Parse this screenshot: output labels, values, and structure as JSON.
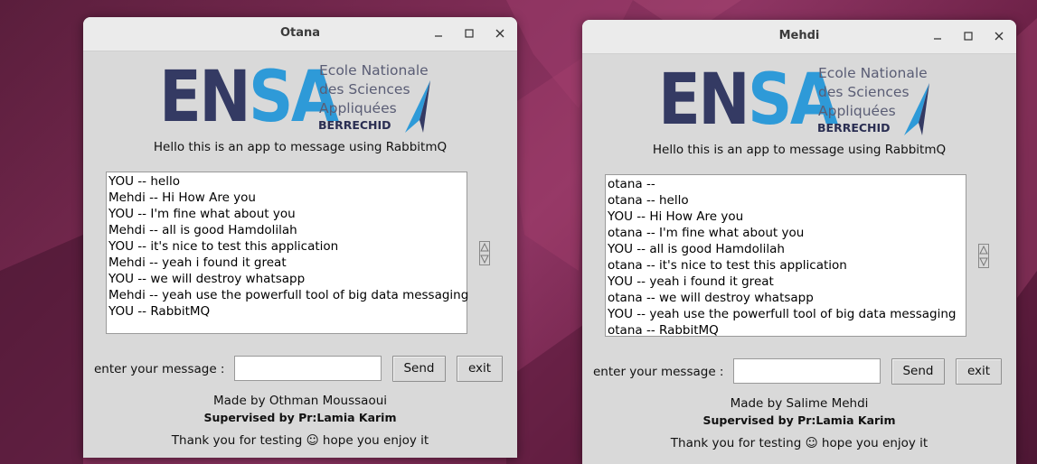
{
  "windows": [
    {
      "title": "Otana",
      "logo": {
        "letters_a": "EN",
        "letters_b": "SA",
        "sub1": "Ecole Nationale",
        "sub2": "des Sciences",
        "sub3": "Appliquées",
        "sub4": "BERRECHID"
      },
      "subtitle": "Hello this is an app to message using RabbitmQ",
      "messages": [
        "YOU -- hello",
        "Mehdi -- Hi How Are you",
        "YOU -- I'm fine what about you",
        "Mehdi -- all is good Hamdolilah",
        "YOU -- it's nice to test this application",
        "Mehdi -- yeah i found it great",
        "YOU -- we will destroy whatsapp",
        "Mehdi -- yeah use the powerfull tool of big data messaging",
        "YOU -- RabbitMQ"
      ],
      "prompt": "enter your message :",
      "entry_value": "",
      "send_label": "Send",
      "exit_label": "exit",
      "made_by": "Made by Othman Moussaoui",
      "supervised": "Supervised by Pr:Lamia Karim",
      "thanks": "Thank you for testing ☺ hope you enjoy it"
    },
    {
      "title": "Mehdi",
      "logo": {
        "letters_a": "EN",
        "letters_b": "SA",
        "sub1": "Ecole Nationale",
        "sub2": "des Sciences",
        "sub3": "Appliquées",
        "sub4": "BERRECHID"
      },
      "subtitle": "Hello this is an app to message using RabbitmQ",
      "messages": [
        "otana --",
        "otana -- hello",
        "YOU -- Hi How Are you",
        "otana -- I'm fine what about you",
        "YOU -- all is good Hamdolilah",
        "otana -- it's nice to test this application",
        "YOU -- yeah i found it great",
        "otana -- we will destroy whatsapp",
        "YOU -- yeah use the powerfull tool of big data messaging",
        "otana -- RabbitMQ"
      ],
      "prompt": "enter your message :",
      "entry_value": "",
      "send_label": "Send",
      "exit_label": "exit",
      "made_by": "Made by Salime Mehdi",
      "supervised": "Supervised by Pr:Lamia Karim",
      "thanks": "Thank you for testing ☺ hope you enjoy it"
    }
  ],
  "colors": {
    "ensa_dark": "#343a63",
    "ensa_blue": "#2e9ad8",
    "window_bg": "#d9d9d9"
  },
  "icons": [
    "minimize-icon",
    "maximize-icon",
    "close-icon",
    "scroll-arrows-icon",
    "logo-arrow-icon"
  ]
}
